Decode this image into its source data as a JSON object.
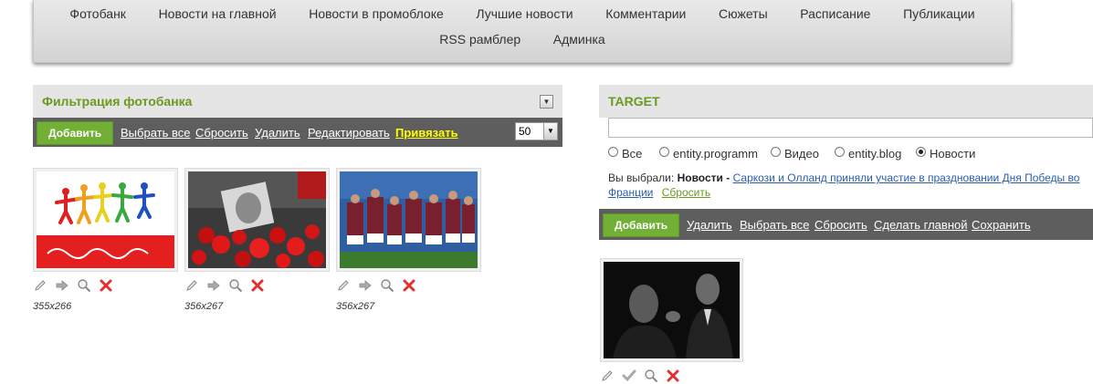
{
  "nav": {
    "row1": [
      "Фотобанк",
      "Новости на главной",
      "Новости в промоблоке",
      "Лучшие новости",
      "Комментарии",
      "Сюжеты",
      "Расписание",
      "Публикации"
    ],
    "row2": [
      "RSS рамблер",
      "Админка"
    ]
  },
  "left_panel": {
    "title": "Фильтрация фотобанка",
    "toolbar": {
      "add": "Добавить",
      "select_all": "Выбрать все",
      "reset": "Сбросить",
      "delete": "Удалить",
      "edit": "Редактировать",
      "attach": "Привязать",
      "per_page": "50"
    },
    "photos": [
      {
        "size": "355x266",
        "depicts": "children-drawing"
      },
      {
        "size": "356x267",
        "depicts": "flowers-memorial"
      },
      {
        "size": "356x267",
        "depicts": "football-team"
      }
    ]
  },
  "right_panel": {
    "title": "TARGET",
    "input_value": "",
    "radios": [
      {
        "label": "Все",
        "checked": false
      },
      {
        "label": "entity.programm",
        "checked": false
      },
      {
        "label": "Видео",
        "checked": false
      },
      {
        "label": "entity.blog",
        "checked": false
      },
      {
        "label": "Новости",
        "checked": true
      }
    ],
    "selected": {
      "prefix": "Вы выбрали:",
      "type": "Новости",
      "separator": "-",
      "link": "Саркози и Олланд приняли участие в праздновании Дня Победы во Франции",
      "reset": "Сбросить"
    },
    "toolbar": {
      "add": "Добавить",
      "delete": "Удалить",
      "select_all": "Выбрать все",
      "reset": "Сбросить",
      "make_main": "Сделать главной",
      "save": "Сохранить"
    },
    "photos": [
      {
        "depicts": "politicians-portrait"
      }
    ]
  },
  "colors": {
    "accent_green": "#6a9a1f",
    "button_green": "#72b035",
    "toolbar_gray": "#5e5e5e",
    "highlight_yellow": "#ffff00",
    "link_blue": "#2a5db0"
  }
}
